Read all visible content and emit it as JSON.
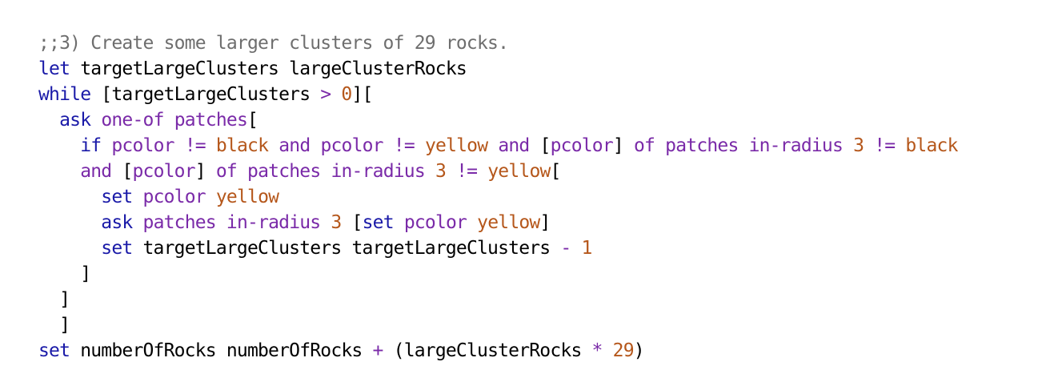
{
  "colors": {
    "comment": "#6e6e6e",
    "command": "#1a1aa8",
    "reporter": "#7a2aa8",
    "constant": "#b5571b",
    "text": "#000000"
  },
  "lines": [
    {
      "indent": "",
      "tokens": [
        {
          "t": ";;3) Create some larger clusters of 29 rocks.",
          "c": "comment"
        }
      ]
    },
    {
      "indent": "",
      "tokens": [
        {
          "t": "let",
          "c": "command"
        },
        {
          "t": " targetLargeClusters largeClusterRocks",
          "c": "text"
        }
      ]
    },
    {
      "indent": "",
      "tokens": [
        {
          "t": "while",
          "c": "command"
        },
        {
          "t": " [targetLargeClusters ",
          "c": "text"
        },
        {
          "t": ">",
          "c": "reporter"
        },
        {
          "t": " ",
          "c": "text"
        },
        {
          "t": "0",
          "c": "constant"
        },
        {
          "t": "][",
          "c": "text"
        }
      ]
    },
    {
      "indent": "  ",
      "tokens": [
        {
          "t": "ask",
          "c": "command"
        },
        {
          "t": " ",
          "c": "text"
        },
        {
          "t": "one-of",
          "c": "reporter"
        },
        {
          "t": " ",
          "c": "text"
        },
        {
          "t": "patches",
          "c": "reporter"
        },
        {
          "t": "[",
          "c": "text"
        }
      ]
    },
    {
      "indent": "    ",
      "tokens": [
        {
          "t": "if",
          "c": "command"
        },
        {
          "t": " ",
          "c": "text"
        },
        {
          "t": "pcolor",
          "c": "reporter"
        },
        {
          "t": " ",
          "c": "text"
        },
        {
          "t": "!=",
          "c": "reporter"
        },
        {
          "t": " ",
          "c": "text"
        },
        {
          "t": "black",
          "c": "constant"
        },
        {
          "t": " ",
          "c": "text"
        },
        {
          "t": "and",
          "c": "reporter"
        },
        {
          "t": " ",
          "c": "text"
        },
        {
          "t": "pcolor",
          "c": "reporter"
        },
        {
          "t": " ",
          "c": "text"
        },
        {
          "t": "!=",
          "c": "reporter"
        },
        {
          "t": " ",
          "c": "text"
        },
        {
          "t": "yellow",
          "c": "constant"
        },
        {
          "t": " ",
          "c": "text"
        },
        {
          "t": "and",
          "c": "reporter"
        },
        {
          "t": " [",
          "c": "text"
        },
        {
          "t": "pcolor",
          "c": "reporter"
        },
        {
          "t": "] ",
          "c": "text"
        },
        {
          "t": "of",
          "c": "reporter"
        },
        {
          "t": " ",
          "c": "text"
        },
        {
          "t": "patches",
          "c": "reporter"
        },
        {
          "t": " ",
          "c": "text"
        },
        {
          "t": "in-radius",
          "c": "reporter"
        },
        {
          "t": " ",
          "c": "text"
        },
        {
          "t": "3",
          "c": "constant"
        },
        {
          "t": " ",
          "c": "text"
        },
        {
          "t": "!=",
          "c": "reporter"
        },
        {
          "t": " ",
          "c": "text"
        },
        {
          "t": "black",
          "c": "constant"
        }
      ]
    },
    {
      "indent": "    ",
      "tokens": [
        {
          "t": "and",
          "c": "reporter"
        },
        {
          "t": " [",
          "c": "text"
        },
        {
          "t": "pcolor",
          "c": "reporter"
        },
        {
          "t": "] ",
          "c": "text"
        },
        {
          "t": "of",
          "c": "reporter"
        },
        {
          "t": " ",
          "c": "text"
        },
        {
          "t": "patches",
          "c": "reporter"
        },
        {
          "t": " ",
          "c": "text"
        },
        {
          "t": "in-radius",
          "c": "reporter"
        },
        {
          "t": " ",
          "c": "text"
        },
        {
          "t": "3",
          "c": "constant"
        },
        {
          "t": " ",
          "c": "text"
        },
        {
          "t": "!=",
          "c": "reporter"
        },
        {
          "t": " ",
          "c": "text"
        },
        {
          "t": "yellow",
          "c": "constant"
        },
        {
          "t": "[",
          "c": "text"
        }
      ]
    },
    {
      "indent": "      ",
      "tokens": [
        {
          "t": "set",
          "c": "command"
        },
        {
          "t": " ",
          "c": "text"
        },
        {
          "t": "pcolor",
          "c": "reporter"
        },
        {
          "t": " ",
          "c": "text"
        },
        {
          "t": "yellow",
          "c": "constant"
        }
      ]
    },
    {
      "indent": "      ",
      "tokens": [
        {
          "t": "ask",
          "c": "command"
        },
        {
          "t": " ",
          "c": "text"
        },
        {
          "t": "patches",
          "c": "reporter"
        },
        {
          "t": " ",
          "c": "text"
        },
        {
          "t": "in-radius",
          "c": "reporter"
        },
        {
          "t": " ",
          "c": "text"
        },
        {
          "t": "3",
          "c": "constant"
        },
        {
          "t": " [",
          "c": "text"
        },
        {
          "t": "set",
          "c": "command"
        },
        {
          "t": " ",
          "c": "text"
        },
        {
          "t": "pcolor",
          "c": "reporter"
        },
        {
          "t": " ",
          "c": "text"
        },
        {
          "t": "yellow",
          "c": "constant"
        },
        {
          "t": "]",
          "c": "text"
        }
      ]
    },
    {
      "indent": "      ",
      "tokens": [
        {
          "t": "set",
          "c": "command"
        },
        {
          "t": " targetLargeClusters targetLargeClusters ",
          "c": "text"
        },
        {
          "t": "-",
          "c": "reporter"
        },
        {
          "t": " ",
          "c": "text"
        },
        {
          "t": "1",
          "c": "constant"
        }
      ]
    },
    {
      "indent": "    ",
      "tokens": [
        {
          "t": "]",
          "c": "text"
        }
      ]
    },
    {
      "indent": "  ",
      "tokens": [
        {
          "t": "]",
          "c": "text"
        }
      ]
    },
    {
      "indent": "  ",
      "tokens": [
        {
          "t": "]",
          "c": "text"
        }
      ]
    },
    {
      "indent": "",
      "tokens": [
        {
          "t": "set",
          "c": "command"
        },
        {
          "t": " numberOfRocks numberOfRocks ",
          "c": "text"
        },
        {
          "t": "+",
          "c": "reporter"
        },
        {
          "t": " (largeClusterRocks ",
          "c": "text"
        },
        {
          "t": "*",
          "c": "reporter"
        },
        {
          "t": " ",
          "c": "text"
        },
        {
          "t": "29",
          "c": "constant"
        },
        {
          "t": ")",
          "c": "text"
        }
      ]
    }
  ]
}
